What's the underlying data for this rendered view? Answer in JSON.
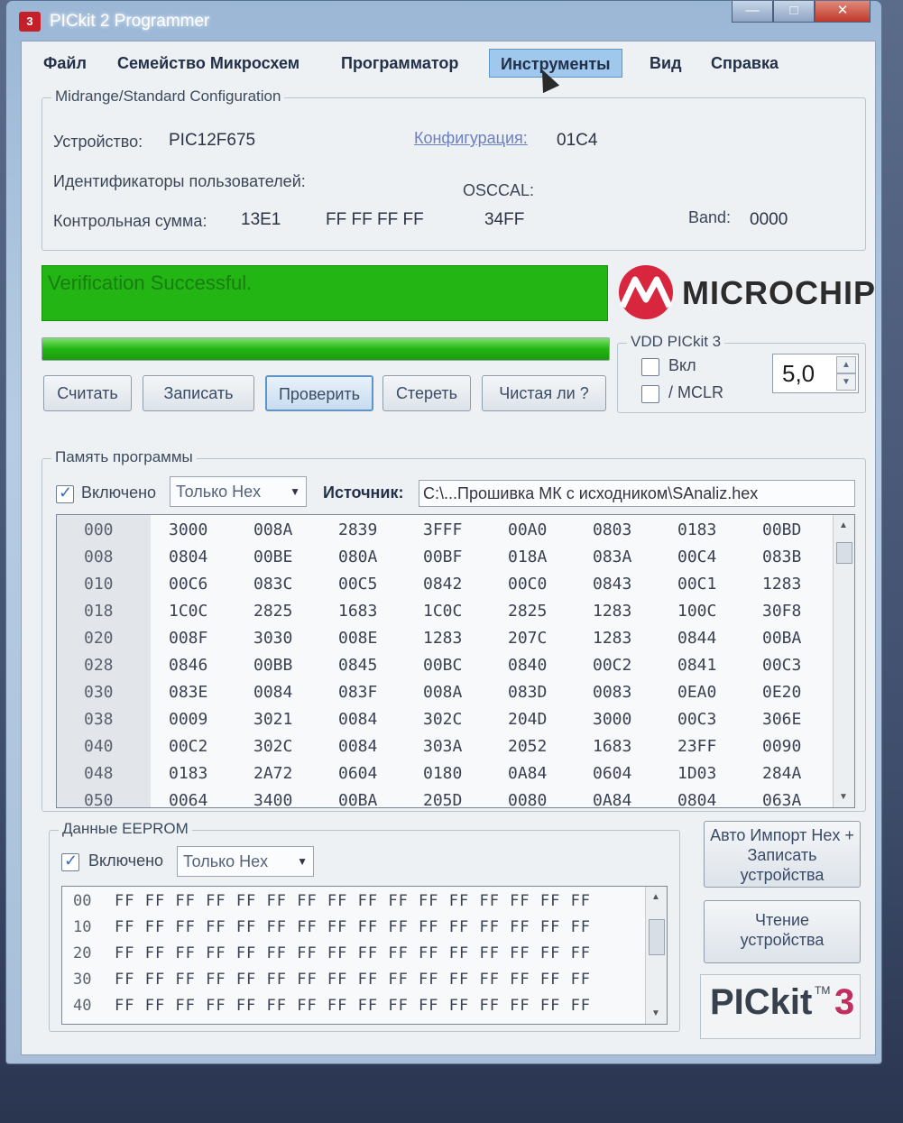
{
  "window": {
    "title": "PICkit 2 Programmer",
    "icon_text": "3",
    "minimize": "—",
    "maximize": "□",
    "close": "✕"
  },
  "menu": {
    "items": [
      "Файл",
      "Семейство Микросхем",
      "Программатор",
      "Инструменты",
      "Вид",
      "Справка"
    ],
    "active_index": 3
  },
  "config": {
    "group_title": "Midrange/Standard Configuration",
    "device_label": "Устройство:",
    "device_value": "PIC12F675",
    "configuration_label": "Конфигурация:",
    "configuration_value": "01C4",
    "user_ids_label": "Идентификаторы пользователей:",
    "user_ids_value": "FF FF FF FF",
    "checksum_label": "Контрольная сумма:",
    "checksum_value": "13E1",
    "osccal_label": "OSCCAL:",
    "osccal_value": "34FF",
    "band_label": "Band:",
    "band_value": "0000"
  },
  "status": {
    "message": "Verification Successful.",
    "progress_fraction": 1.0,
    "color": "#22b513"
  },
  "logo": {
    "brand": "MICROCHIP",
    "brand_color": "#d7263d"
  },
  "actions": {
    "read": "Считать",
    "write": "Записать",
    "verify": "Проверить",
    "erase": "Стереть",
    "blank_check": "Чистая ли ?"
  },
  "vdd": {
    "group_title": "VDD PICkit 3",
    "on_label": "Вкл",
    "on_checked": false,
    "mclr_label": "/ MCLR",
    "mclr_checked": false,
    "voltage": "5,0"
  },
  "program_memory": {
    "title": "Память программы",
    "enabled_label": "Включено",
    "enabled_checked": true,
    "view_mode": "Только Hex",
    "source_label": "Источник:",
    "source_path": "C:\\...Прошивка МК с исходником\\SAnaliz.hex",
    "rows": [
      {
        "addr": "000",
        "words": [
          "3000",
          "008A",
          "2839",
          "3FFF",
          "00A0",
          "0803",
          "0183",
          "00BD"
        ]
      },
      {
        "addr": "008",
        "words": [
          "0804",
          "00BE",
          "080A",
          "00BF",
          "018A",
          "083A",
          "00C4",
          "083B"
        ]
      },
      {
        "addr": "010",
        "words": [
          "00C6",
          "083C",
          "00C5",
          "0842",
          "00C0",
          "0843",
          "00C1",
          "1283"
        ]
      },
      {
        "addr": "018",
        "words": [
          "1C0C",
          "2825",
          "1683",
          "1C0C",
          "2825",
          "1283",
          "100C",
          "30F8"
        ]
      },
      {
        "addr": "020",
        "words": [
          "008F",
          "3030",
          "008E",
          "1283",
          "207C",
          "1283",
          "0844",
          "00BA"
        ]
      },
      {
        "addr": "028",
        "words": [
          "0846",
          "00BB",
          "0845",
          "00BC",
          "0840",
          "00C2",
          "0841",
          "00C3"
        ]
      },
      {
        "addr": "030",
        "words": [
          "083E",
          "0084",
          "083F",
          "008A",
          "083D",
          "0083",
          "0EA0",
          "0E20"
        ]
      },
      {
        "addr": "038",
        "words": [
          "0009",
          "3021",
          "0084",
          "302C",
          "204D",
          "3000",
          "00C3",
          "306E"
        ]
      },
      {
        "addr": "040",
        "words": [
          "00C2",
          "302C",
          "0084",
          "303A",
          "2052",
          "1683",
          "23FF",
          "0090"
        ]
      },
      {
        "addr": "048",
        "words": [
          "0183",
          "2A72",
          "0604",
          "0180",
          "0A84",
          "0604",
          "1D03",
          "284A"
        ]
      },
      {
        "addr": "050",
        "words": [
          "0064",
          "3400",
          "00BA",
          "205D",
          "0080",
          "0A84",
          "0804",
          "063A"
        ]
      }
    ]
  },
  "eeprom": {
    "title": "Данные EEPROM",
    "enabled_label": "Включено",
    "enabled_checked": true,
    "view_mode": "Только Hex",
    "rows": [
      {
        "addr": "00",
        "bytes": "FF FF FF FF FF FF FF FF FF FF FF FF FF FF FF FF"
      },
      {
        "addr": "10",
        "bytes": "FF FF FF FF FF FF FF FF FF FF FF FF FF FF FF FF"
      },
      {
        "addr": "20",
        "bytes": "FF FF FF FF FF FF FF FF FF FF FF FF FF FF FF FF"
      },
      {
        "addr": "30",
        "bytes": "FF FF FF FF FF FF FF FF FF FF FF FF FF FF FF FF"
      },
      {
        "addr": "40",
        "bytes": "FF FF FF FF FF FF FF FF FF FF FF FF FF FF FF FF"
      }
    ]
  },
  "side_buttons": {
    "auto_import": "Авто Импорт Hex + Записать устройства",
    "read_device": "Чтение устройства"
  },
  "pickit_logo": {
    "text": "PICkit",
    "tm": "TM",
    "number": "3"
  }
}
